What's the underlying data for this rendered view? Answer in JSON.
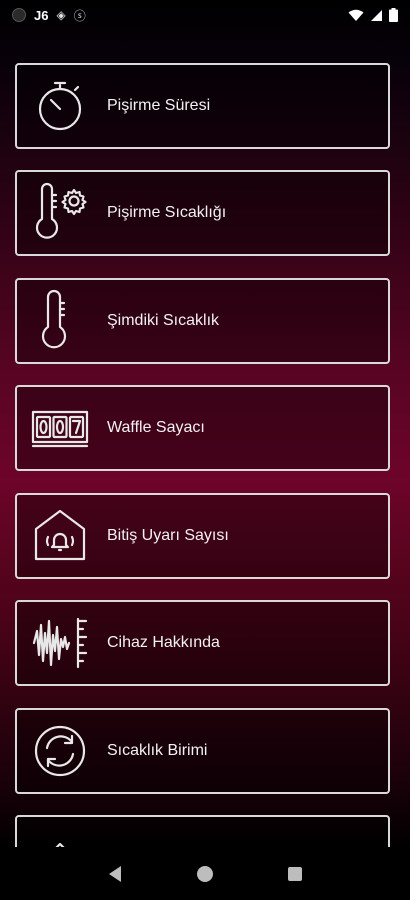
{
  "status_bar": {
    "left_text": "J6",
    "icons": [
      "app-notification-icon",
      "signal-badge-icon",
      "sync-badge-icon"
    ],
    "right_icons": [
      "wifi-icon",
      "cellular-signal-icon",
      "battery-icon"
    ]
  },
  "menu": {
    "items": [
      {
        "label": "Pişirme Süresi",
        "icon": "stopwatch-icon"
      },
      {
        "label": "Pişirme Sıcaklığı",
        "icon": "thermometer-gear-icon"
      },
      {
        "label": "Şimdiki Sıcaklık",
        "icon": "thermometer-icon"
      },
      {
        "label": "Waffle Sayacı",
        "icon": "counter-007-icon",
        "counter_digits": [
          "0",
          "0",
          "7"
        ]
      },
      {
        "label": "Bitiş Uyarı Sayısı",
        "icon": "house-bell-icon"
      },
      {
        "label": "Cihaz Hakkında",
        "icon": "sound-wave-ruler-icon"
      },
      {
        "label": "Sıcaklık Birimi",
        "icon": "refresh-circle-icon"
      },
      {
        "label": "",
        "icon": "partial-item-icon"
      }
    ]
  },
  "colors": {
    "border": "#d9d9d9",
    "text": "#f2f2f2",
    "accent_gradient_mid": "#6d0429"
  },
  "nav": {
    "icons": [
      "back-icon",
      "home-icon",
      "recents-icon"
    ]
  }
}
